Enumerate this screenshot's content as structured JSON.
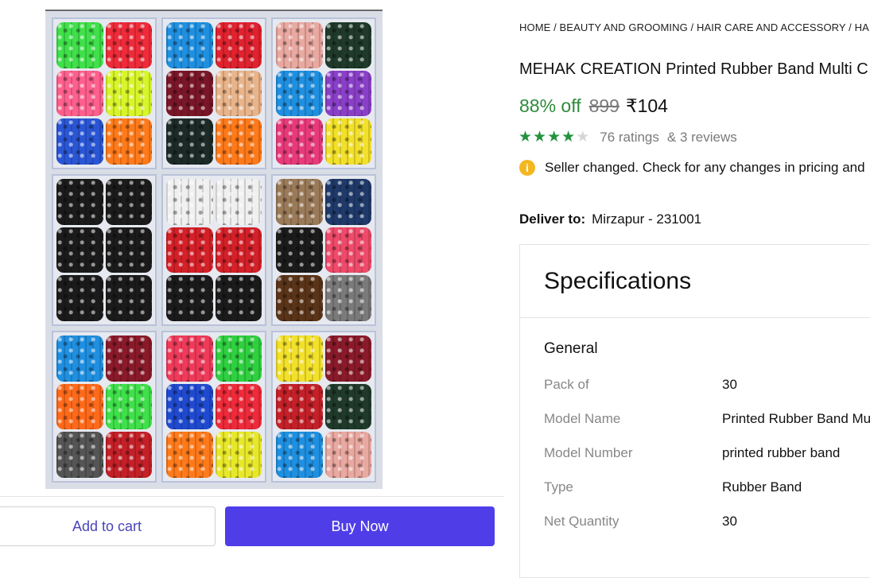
{
  "breadcrumb": "HOME / BEAUTY AND GROOMING / HAIR CARE AND ACCESSORY / HAIR A",
  "product": {
    "title": "MEHAK CREATION Printed Rubber Band Multi C",
    "discount": "88% off",
    "mrp": "899",
    "price": "₹104",
    "rating_stars": 4,
    "rating_max": 5,
    "ratings_text": "76 ratings",
    "reviews_text": "& 3 reviews"
  },
  "notice": {
    "icon": "info-icon",
    "text": "Seller changed. Check for any changes in pricing and"
  },
  "delivery": {
    "label": "Deliver to:",
    "location": "Mirzapur - 231001"
  },
  "specifications": {
    "title": "Specifications",
    "section": "General",
    "rows": [
      {
        "key": "Pack of",
        "value": "30"
      },
      {
        "key": "Model Name",
        "value": "Printed Rubber Band Mu"
      },
      {
        "key": "Model Number",
        "value": "printed rubber band"
      },
      {
        "key": "Type",
        "value": "Rubber Band"
      },
      {
        "key": "Net Quantity",
        "value": "30"
      }
    ]
  },
  "actions": {
    "add_to_cart": "Add to cart",
    "buy_now": "Buy Now"
  },
  "colors": {
    "accent": "#4f3ee8",
    "discount_green": "#2e8b3a",
    "star_green": "#23923d",
    "notice_yellow": "#f3b81f"
  },
  "image": {
    "bundle_colors": [
      [
        "#3fe04a",
        "#ef2b3a",
        "#ff5f8c",
        "#d8f52a",
        "#2a56d6",
        "#ff7a1a"
      ],
      [
        "#1f8fe0",
        "#e0222f",
        "#7a1628",
        "#e9b48a",
        "#1c2a28",
        "#ff7a1a"
      ],
      [
        "#e9a8a0",
        "#1f3a2a",
        "#1f8fe0",
        "#8a3fc8",
        "#e83a7a",
        "#f2e02a"
      ],
      [
        "#1b1b1b",
        "#1b1b1b",
        "#1b1b1b",
        "#1b1b1b",
        "#1b1b1b",
        "#1b1b1b"
      ],
      [
        "#f0f0f0",
        "#f0f0f0",
        "#d42028",
        "#d42028",
        "#1b1b1b",
        "#1b1b1b"
      ],
      [
        "#9a7a58",
        "#1f3a6a",
        "#1b1b1b",
        "#ef4a6a",
        "#5a3418",
        "#7a7a7a"
      ],
      [
        "#1f8fe0",
        "#8a1a2a",
        "#ff6a1a",
        "#3fe04a",
        "#555555",
        "#c42028"
      ],
      [
        "#ef3a5a",
        "#2fd040",
        "#1f4ad0",
        "#ef2a3a",
        "#ff7a1a",
        "#e8e82a"
      ],
      [
        "#f2e02a",
        "#8a1a2a",
        "#c42028",
        "#1f3a2a",
        "#1f8fe0",
        "#e9a8a0"
      ]
    ]
  }
}
